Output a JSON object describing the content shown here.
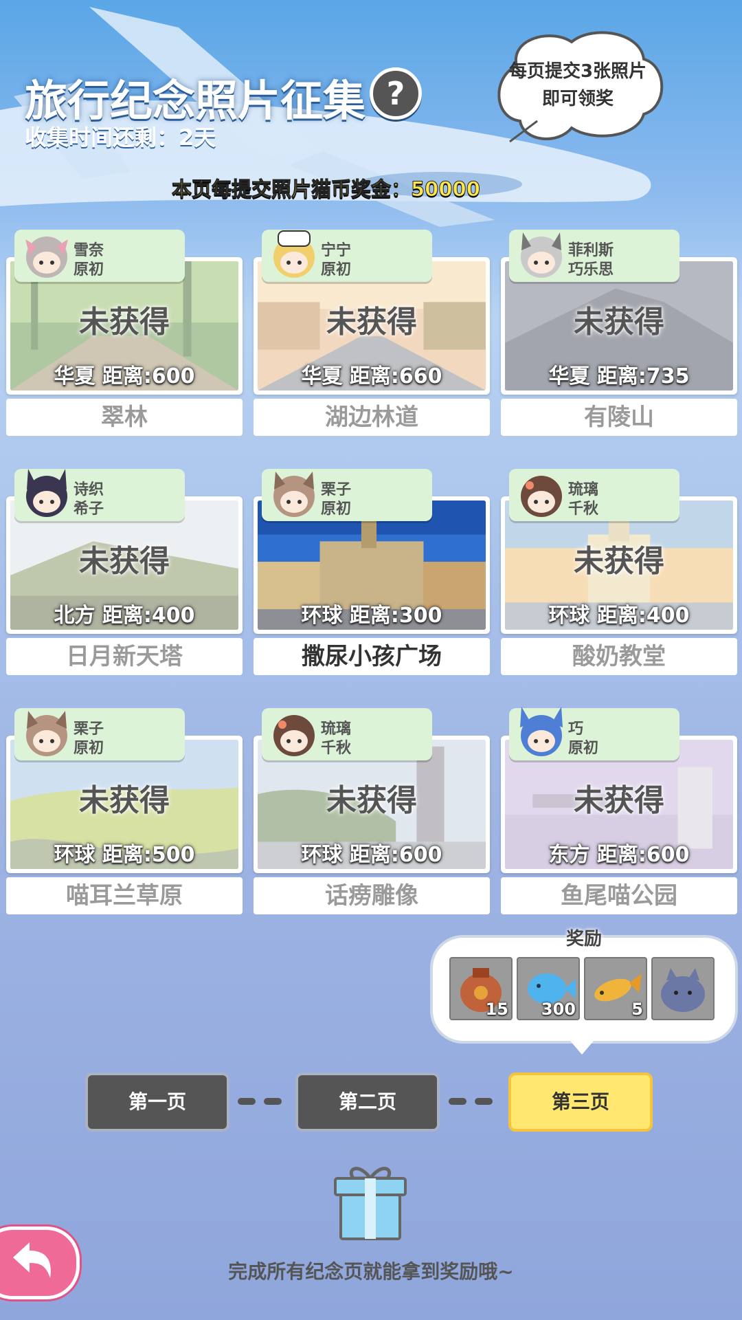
{
  "header": {
    "title": "旅行纪念照片征集",
    "help_symbol": "?",
    "timer_text": "收集时间还剩：2天",
    "bonus_text": "本页每提交照片猫币奖金：50000",
    "hint_line1": "每页提交3张照片",
    "hint_line2": "即可领奖"
  },
  "cards": [
    {
      "char1": "雪奈",
      "char2": "原初",
      "status": "未获得",
      "distance": "华夏  距离:600",
      "name": "翠林"
    },
    {
      "char1": "宁宁",
      "char2": "原初",
      "status": "未获得",
      "distance": "华夏  距离:660",
      "name": "湖边林道"
    },
    {
      "char1": "菲利斯",
      "char2": "巧乐思",
      "status": "未获得",
      "distance": "华夏  距离:735",
      "name": "有陵山"
    },
    {
      "char1": "诗织",
      "char2": "希子",
      "status": "未获得",
      "distance": "北方  距离:400",
      "name": "日月新天塔"
    },
    {
      "char1": "栗子",
      "char2": "原初",
      "status": "",
      "distance": "环球  距离:300",
      "name": "撒尿小孩广场"
    },
    {
      "char1": "琉璃",
      "char2": "千秋",
      "status": "未获得",
      "distance": "环球  距离:400",
      "name": "酸奶教堂"
    },
    {
      "char1": "栗子",
      "char2": "原初",
      "status": "未获得",
      "distance": "环球  距离:500",
      "name": "喵耳兰草原"
    },
    {
      "char1": "琉璃",
      "char2": "千秋",
      "status": "未获得",
      "distance": "环球  距离:600",
      "name": "话痨雕像"
    },
    {
      "char1": "巧",
      "char2": "原初",
      "status": "未获得",
      "distance": "东方  距离:600",
      "name": "鱼尾喵公园"
    }
  ],
  "reward": {
    "title": "奖励",
    "items": [
      {
        "icon": "treasure-bag-icon",
        "count": "15"
      },
      {
        "icon": "blue-fish-plush-icon",
        "count": "300"
      },
      {
        "icon": "golden-fish-icon",
        "count": "5"
      },
      {
        "icon": "cat-plush-icon",
        "count": ""
      }
    ]
  },
  "pages": [
    "第一页",
    "第二页",
    "第三页"
  ],
  "current_page": 2,
  "footer_text": "完成所有纪念页就能拿到奖励哦~",
  "colors": {
    "accent": "#ffe770",
    "button_dark": "#555555",
    "tag_bg": "#dcf3d8",
    "back_button": "#f06a98"
  }
}
